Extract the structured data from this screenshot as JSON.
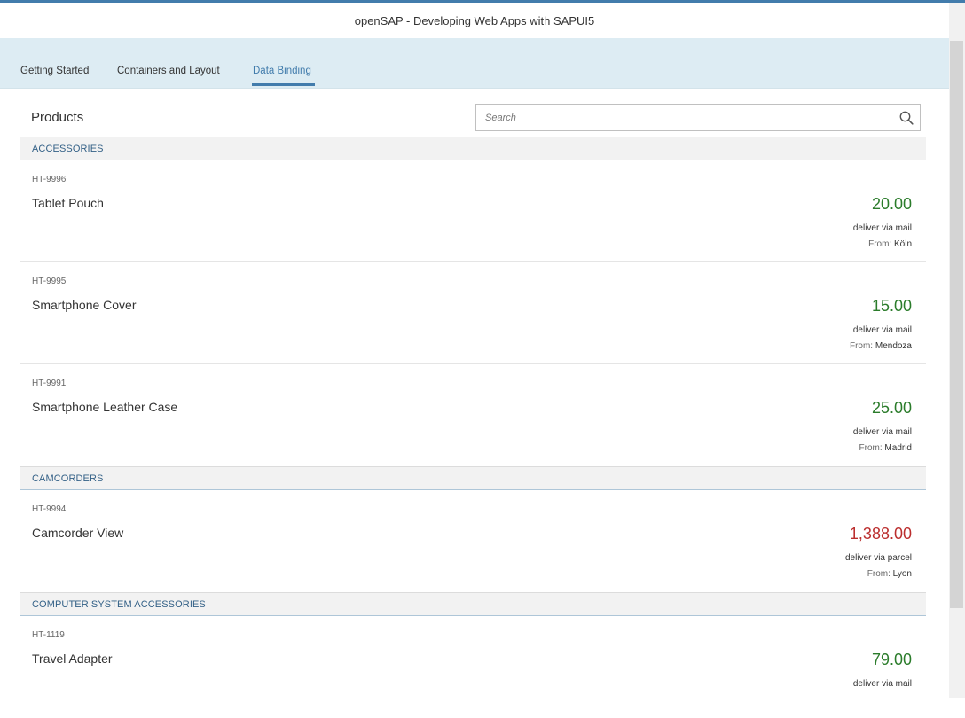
{
  "app": {
    "title": "openSAP - Developing Web Apps with SAPUI5"
  },
  "tabs": [
    {
      "label": "Getting Started",
      "selected": false
    },
    {
      "label": "Containers and Layout",
      "selected": false
    },
    {
      "label": "Data Binding",
      "selected": true
    }
  ],
  "products": {
    "title": "Products",
    "search": {
      "placeholder": "Search",
      "value": ""
    },
    "from_label": "From:",
    "groups": [
      {
        "name": "ACCESSORIES",
        "items": [
          {
            "id": "HT-9996",
            "name": "Tablet Pouch",
            "price": "20.00",
            "price_state": "success",
            "delivery": "deliver via mail",
            "from": "Köln"
          },
          {
            "id": "HT-9995",
            "name": "Smartphone Cover",
            "price": "15.00",
            "price_state": "success",
            "delivery": "deliver via mail",
            "from": "Mendoza"
          },
          {
            "id": "HT-9991",
            "name": "Smartphone Leather Case",
            "price": "25.00",
            "price_state": "success",
            "delivery": "deliver via mail",
            "from": "Madrid"
          }
        ]
      },
      {
        "name": "CAMCORDERS",
        "items": [
          {
            "id": "HT-9994",
            "name": "Camcorder View",
            "price": "1,388.00",
            "price_state": "error",
            "delivery": "deliver via parcel",
            "from": "Lyon"
          }
        ]
      },
      {
        "name": "COMPUTER SYSTEM ACCESSORIES",
        "items": [
          {
            "id": "HT-1119",
            "name": "Travel Adapter",
            "price": "79.00",
            "price_state": "success",
            "delivery": "deliver via mail",
            "from": ""
          }
        ]
      }
    ]
  },
  "colors": {
    "accent": "#427cac",
    "success": "#2b7c2b",
    "error": "#bb2e2e",
    "tab_bar": "#ddecf3"
  }
}
